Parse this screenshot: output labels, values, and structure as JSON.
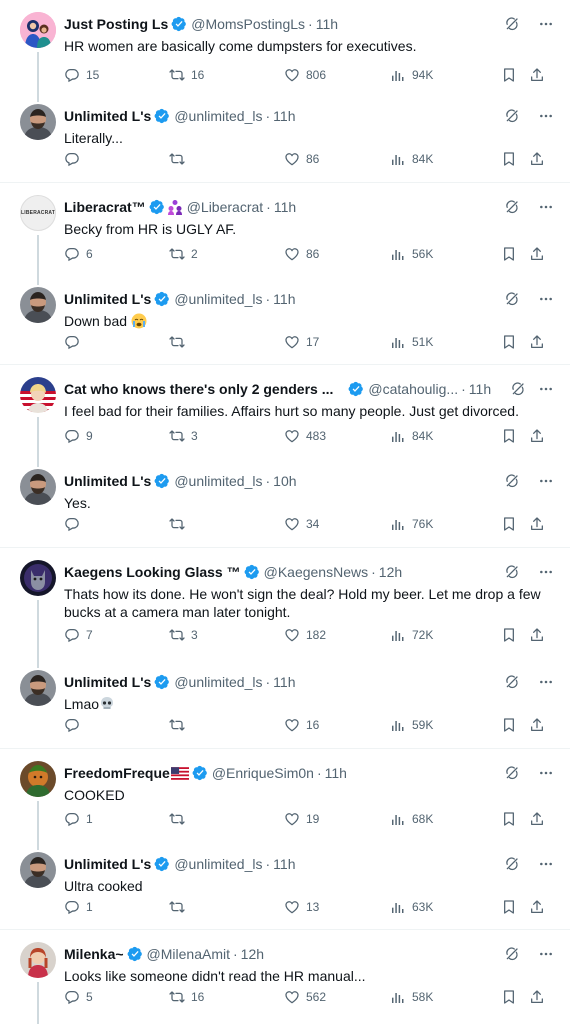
{
  "tweets": [
    {
      "name": "Just Posting Ls",
      "handle": "@MomsPostingLs",
      "time": "11h",
      "text": "HR women are basically come dumpsters for executives.",
      "replies": "15",
      "retweets": "16",
      "likes": "806",
      "views": "94K"
    },
    {
      "name": "Unlimited L's",
      "handle": "@unlimited_ls",
      "time": "11h",
      "text": "Literally...",
      "replies": "",
      "retweets": "",
      "likes": "86",
      "views": "84K"
    },
    {
      "name": "Liberacrat™",
      "handle": "@Liberacrat",
      "time": "11h",
      "text": "Becky from HR is UGLY AF.",
      "replies": "6",
      "retweets": "2",
      "likes": "86",
      "views": "56K",
      "avatar_text": "LIBERACRAT"
    },
    {
      "name": "Unlimited L's",
      "handle": "@unlimited_ls",
      "time": "11h",
      "text": "Down bad",
      "replies": "",
      "retweets": "",
      "likes": "17",
      "views": "51K"
    },
    {
      "name": "Cat who knows there's only 2 genders ...",
      "handle": "@catahoulig...",
      "time": "11h",
      "text": "I feel bad for their families. Affairs hurt so many people. Just get divorced.",
      "replies": "9",
      "retweets": "3",
      "likes": "483",
      "views": "84K"
    },
    {
      "name": "Unlimited L's",
      "handle": "@unlimited_ls",
      "time": "10h",
      "text": "Yes.",
      "replies": "",
      "retweets": "",
      "likes": "34",
      "views": "76K"
    },
    {
      "name": "Kaegens Looking Glass ™",
      "handle": "@KaegensNews",
      "time": "12h",
      "text": "Thats how its done. He won't sign the deal? Hold my beer. Let me drop a few bucks at a camera man later tonight.",
      "replies": "7",
      "retweets": "3",
      "likes": "182",
      "views": "72K"
    },
    {
      "name": "Unlimited L's",
      "handle": "@unlimited_ls",
      "time": "11h",
      "text": "Lmao",
      "replies": "",
      "retweets": "",
      "likes": "16",
      "views": "59K"
    },
    {
      "name": "FreedomFreque",
      "handle": "@EnriqueSim0n",
      "time": "11h",
      "text": "COOKED",
      "replies": "1",
      "retweets": "",
      "likes": "19",
      "views": "68K"
    },
    {
      "name": "Unlimited L's",
      "handle": "@unlimited_ls",
      "time": "11h",
      "text": "Ultra cooked",
      "replies": "1",
      "retweets": "",
      "likes": "13",
      "views": "63K"
    },
    {
      "name": "Milenka~",
      "handle": "@MilenaAmit",
      "time": "12h",
      "text": "Looks like someone didn't read the HR manual...",
      "replies": "5",
      "retweets": "16",
      "likes": "562",
      "views": "58K"
    }
  ],
  "colors": {
    "verified": "#1d9bf0",
    "text": "#0f1419",
    "muted": "#536471",
    "divider": "#eff3f4",
    "thread": "#cfd9de"
  },
  "icons": {
    "reply": "reply-icon",
    "retweet": "retweet-icon",
    "like": "heart-icon",
    "views": "views-icon",
    "bookmark": "bookmark-icon",
    "share": "share-icon",
    "grok": "grok-icon",
    "more": "more-icon",
    "verified": "verified-icon"
  }
}
